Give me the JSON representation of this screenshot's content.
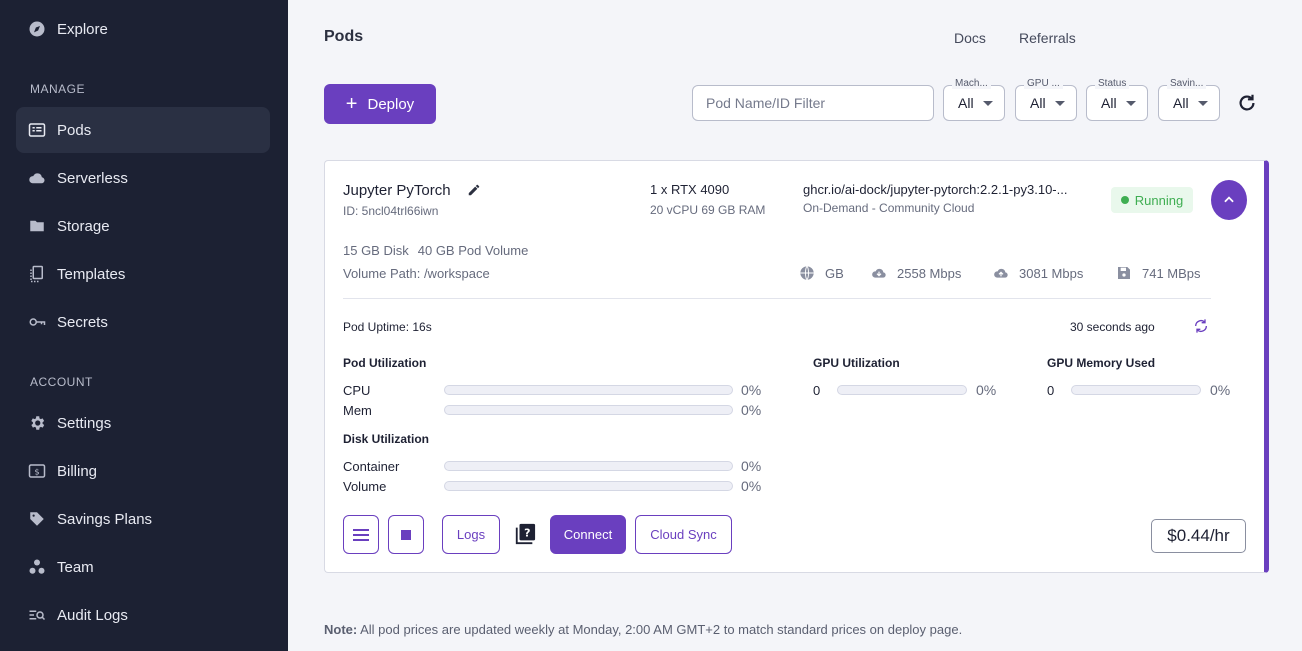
{
  "sidebar": {
    "explore": "Explore",
    "manage_header": "MANAGE",
    "manage": [
      {
        "label": "Pods",
        "icon": "pods-icon",
        "active": true
      },
      {
        "label": "Serverless",
        "icon": "cloud-icon"
      },
      {
        "label": "Storage",
        "icon": "folder-icon"
      },
      {
        "label": "Templates",
        "icon": "template-icon"
      },
      {
        "label": "Secrets",
        "icon": "key-icon"
      }
    ],
    "account_header": "ACCOUNT",
    "account": [
      {
        "label": "Settings",
        "icon": "gear-icon"
      },
      {
        "label": "Billing",
        "icon": "dollar-icon"
      },
      {
        "label": "Savings Plans",
        "icon": "tag-icon"
      },
      {
        "label": "Team",
        "icon": "team-icon"
      },
      {
        "label": "Audit Logs",
        "icon": "audit-icon"
      }
    ]
  },
  "header": {
    "title": "Pods",
    "links": [
      "Docs",
      "Referrals"
    ]
  },
  "toolbar": {
    "deploy_label": "Deploy",
    "filter_placeholder": "Pod Name/ID Filter",
    "selects": [
      {
        "label": "Mach...",
        "value": "All"
      },
      {
        "label": "GPU ...",
        "value": "All"
      },
      {
        "label": "Status",
        "value": "All"
      },
      {
        "label": "Savin...",
        "value": "All"
      }
    ]
  },
  "pod": {
    "name": "Jupyter PyTorch",
    "id": "ID: 5ncl04trl66iwn",
    "gpu": "1 x RTX 4090",
    "spec": "20 vCPU 69 GB RAM",
    "image": "ghcr.io/ai-dock/jupyter-pytorch:2.2.1-py3.10-...",
    "cloud": "On-Demand - Community Cloud",
    "status": "Running",
    "disk": "15 GB Disk",
    "volume": "40 GB Pod Volume",
    "volume_path": "Volume Path: /workspace",
    "net_gb": "GB",
    "download": "2558 Mbps",
    "upload": "3081 Mbps",
    "disk_speed": "741 MBps",
    "uptime": "Pod Uptime: 16s",
    "updated": "30 seconds ago",
    "pod_util_title": "Pod Utilization",
    "cpu_label": "CPU",
    "cpu_pct": "0%",
    "mem_label": "Mem",
    "mem_pct": "0%",
    "disk_util_title": "Disk Utilization",
    "container_label": "Container",
    "container_pct": "0%",
    "volume_label": "Volume",
    "volume_pct": "0%",
    "gpu_util_title": "GPU Utilization",
    "gpu_index": "0",
    "gpu_pct": "0%",
    "gpu_mem_title": "GPU Memory Used",
    "gpu_mem_index": "0",
    "gpu_mem_pct": "0%",
    "levels": {
      "cpu": 0,
      "mem": 0,
      "container": 0,
      "volume": 0,
      "gpu": 0,
      "gpu_mem": 0
    },
    "buttons": {
      "logs": "Logs",
      "connect": "Connect",
      "cloud_sync": "Cloud Sync"
    },
    "price": "$0.44/hr"
  },
  "note": {
    "bold": "Note:",
    "text": " All pod prices are updated weekly at Monday, 2:00 AM GMT+2 to match standard prices on deploy page."
  },
  "colors": {
    "accent": "#6a3fbf",
    "sidebar": "#1c2133",
    "running": "#3fae52"
  }
}
